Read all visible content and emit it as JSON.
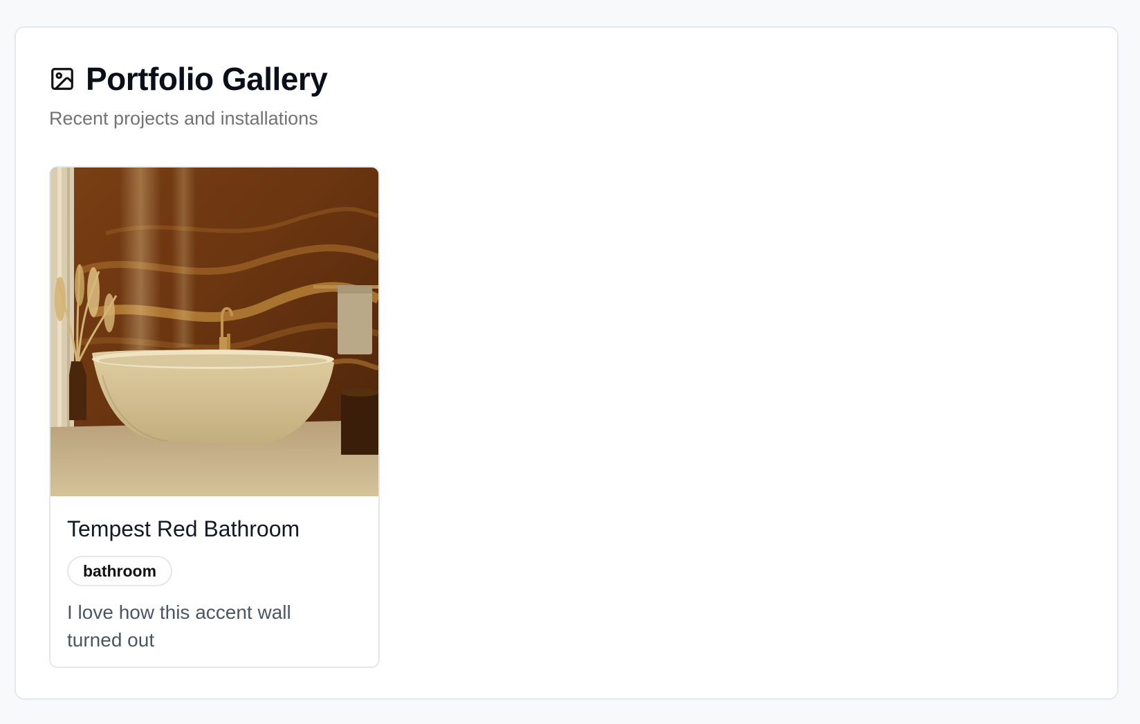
{
  "gallery": {
    "title": "Portfolio Gallery",
    "subtitle": "Recent projects and installations",
    "title_icon": "image-icon"
  },
  "projects": [
    {
      "title": "Tempest Red Bathroom",
      "tag": "bathroom",
      "description": "I love how this accent wall turned out",
      "image_description_icon": "bathroom-photo"
    }
  ],
  "colors": {
    "page_background": "#f8f9fb",
    "panel_background": "#ffffff",
    "border": "#e5e7eb",
    "title_text": "#0b0f19",
    "subtitle_text": "#737373",
    "card_title_text": "#121826",
    "description_text": "#4b5563"
  }
}
